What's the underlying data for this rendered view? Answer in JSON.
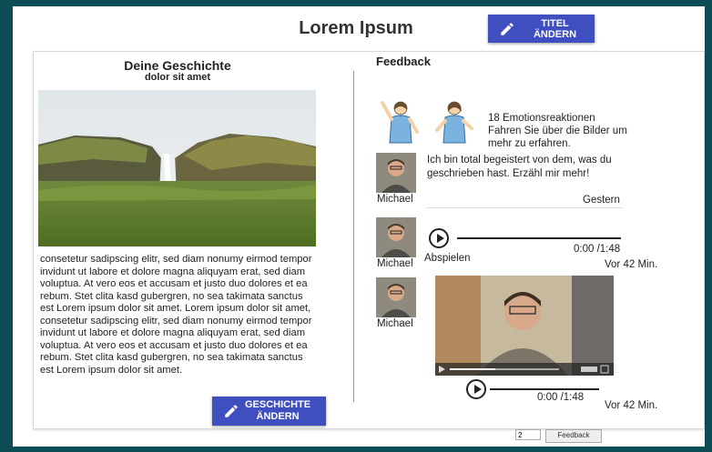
{
  "header": {
    "title": "Lorem Ipsum",
    "edit_title_label": "TITEL ÄNDERN"
  },
  "story": {
    "title": "Deine Geschichte",
    "subtitle": "dolor sit amet",
    "image_icon": "landscape-waterfall-photo",
    "text": "consetetur sadipscing elitr, sed diam nonumy eirmod tempor invidunt ut labore et dolore magna aliquyam erat, sed diam voluptua. At vero eos et accusam et justo duo dolores et ea rebum. Stet clita kasd gubergren, no sea takimata sanctus est Lorem ipsum dolor sit amet. Lorem ipsum dolor sit amet, consetetur sadipscing elitr, sed diam nonumy eirmod tempor invidunt ut labore et dolore magna aliquyam erat, sed diam voluptua. At vero eos et accusam et justo duo dolores et ea rebum. Stet clita kasd gubergren, no sea takimata sanctus est Lorem ipsum dolor sit amet.",
    "edit_story_label_1": "GESCHICHTE",
    "edit_story_label_2": "ÄNDERN"
  },
  "feedback": {
    "title": "Feedback",
    "emotions": {
      "count_text": "18  Emotionsreaktionen",
      "hint_text": "Fahren Sie über die Bilder um mehr zu erfahren."
    },
    "items": [
      {
        "type": "text",
        "author": "Michael",
        "text": "Ich bin total begeistert von dem, was du geschrieben hast. Erzähl mir mehr!",
        "time": "Gestern"
      },
      {
        "type": "audio",
        "author": "Michael",
        "play_label": "Abspielen",
        "duration": "0:00 /1:48",
        "time": "Vor 42 Min."
      },
      {
        "type": "video",
        "author": "Michael",
        "duration": "0:00 /1:48",
        "time": "Vor 42 Min."
      }
    ]
  },
  "footer": {
    "page_input_value": "2",
    "feedback_button_label": "Feedback"
  },
  "colors": {
    "background": "#0c4c54",
    "primary_button": "#3f4fc0"
  }
}
